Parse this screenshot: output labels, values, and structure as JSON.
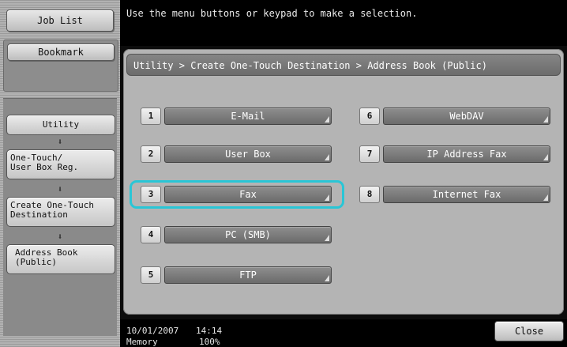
{
  "left": {
    "job_list": "Job List",
    "bookmark": "Bookmark",
    "crumbs": [
      {
        "label": "Utility"
      },
      {
        "label1": "One-Touch/",
        "label2": "User Box Reg."
      },
      {
        "label1": "Create One-Touch",
        "label2": "Destination"
      },
      {
        "label1": "Address Book",
        "label2": "(Public)"
      }
    ],
    "arrow": "⬇"
  },
  "header": {
    "message": "Use the menu buttons or keypad to make a selection."
  },
  "panel": {
    "breadcrumb": "Utility > Create One-Touch Destination > Address Book (Public)",
    "items": [
      {
        "num": "1",
        "label": "E-Mail"
      },
      {
        "num": "2",
        "label": "User Box"
      },
      {
        "num": "3",
        "label": "Fax"
      },
      {
        "num": "4",
        "label": "PC (SMB)"
      },
      {
        "num": "5",
        "label": "FTP"
      },
      {
        "num": "6",
        "label": "WebDAV"
      },
      {
        "num": "7",
        "label": "IP Address Fax"
      },
      {
        "num": "8",
        "label": "Internet Fax"
      }
    ],
    "selected": "3",
    "selection_color": "#29c6d6"
  },
  "footer": {
    "date": "10/01/2007",
    "time": "14:14",
    "memory_label": "Memory",
    "memory_value": "100%",
    "close": "Close"
  }
}
